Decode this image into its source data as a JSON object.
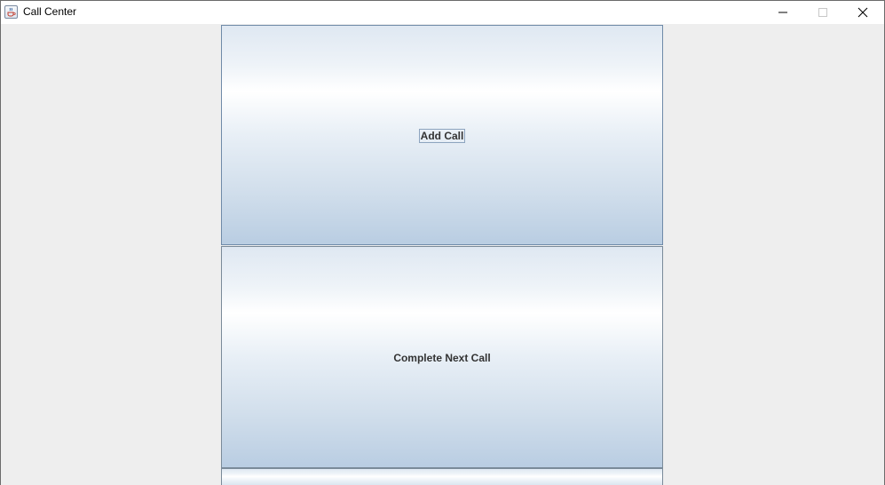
{
  "window": {
    "title": "Call Center",
    "icon": "java-cup-icon",
    "controls": {
      "minimize": "minimize-icon",
      "maximize": "maximize-icon",
      "close": "close-icon"
    }
  },
  "buttons": {
    "add_call": "Add Call",
    "complete_next_call": "Complete Next Call",
    "third": ""
  },
  "colors": {
    "background": "#eeeeee",
    "button_top": "#ffffff",
    "button_bottom": "#b9cde2",
    "button_text": "#333333"
  }
}
